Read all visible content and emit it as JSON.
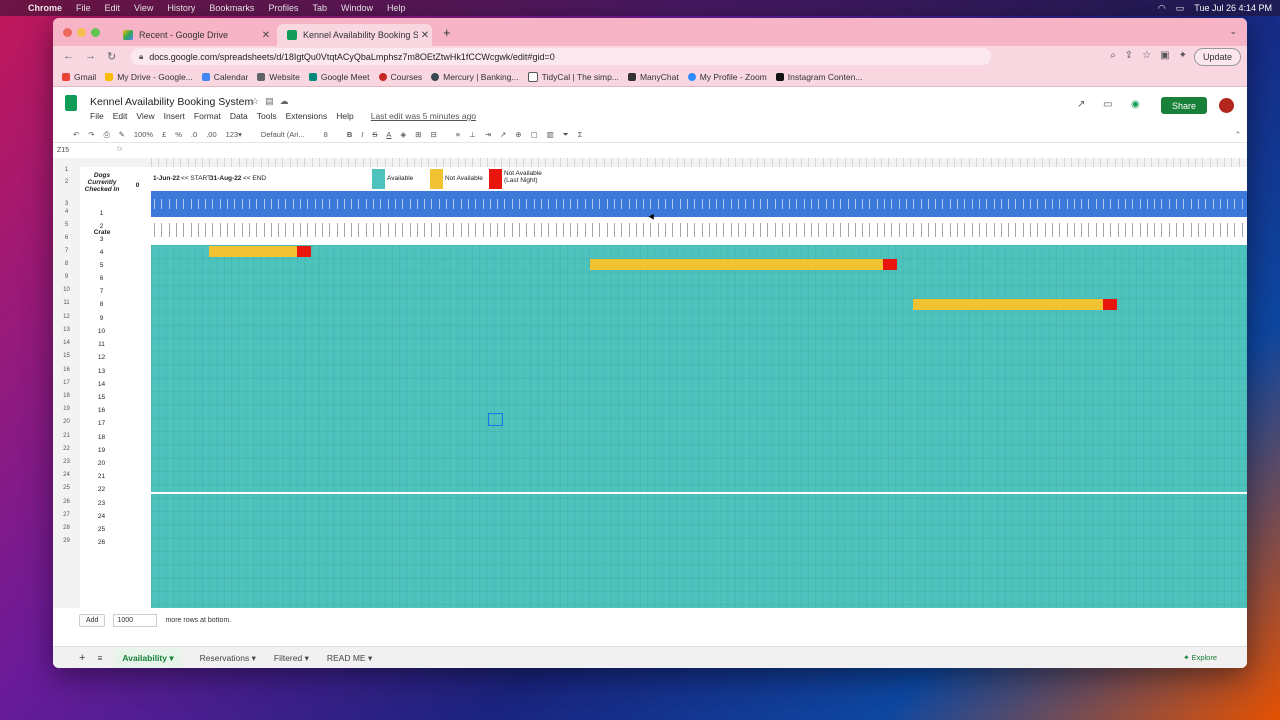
{
  "menubar": {
    "app": "Chrome",
    "items": [
      "File",
      "Edit",
      "View",
      "History",
      "Bookmarks",
      "Profiles",
      "Tab",
      "Window",
      "Help"
    ],
    "datetime": "Tue Jul 26  4:14 PM"
  },
  "tabs": [
    {
      "label": "Recent - Google Drive",
      "active": false
    },
    {
      "label": "Kennel Availability Booking Sy",
      "active": true
    }
  ],
  "omnibox": {
    "url": "docs.google.com/spreadsheets/d/18IgtQu0VtqtACyQbaLmphsz7m8OEtZtwHk1fCCWcgwk/edit#gid=0"
  },
  "update_label": "Update",
  "bookmarks": [
    "Gmail",
    "My Drive - Google...",
    "Calendar",
    "Website",
    "Google Meet",
    "Courses",
    "Mercury | Banking...",
    "TidyCal | The simp...",
    "ManyChat",
    "My Profile - Zoom",
    "Instagram Conten..."
  ],
  "sheet": {
    "title": "Kennel Availability Booking System",
    "menus": [
      "File",
      "Edit",
      "View",
      "Insert",
      "Format",
      "Data",
      "Tools",
      "Extensions",
      "Help"
    ],
    "last_edit": "Last edit was 5 minutes ago",
    "share_label": "Share",
    "zoom": "100%",
    "font": "Default (Ari...",
    "font_size": "8",
    "name_box": "Z15",
    "fx": "fx"
  },
  "grid": {
    "dogs_label": "Dogs Currently Checked In",
    "dogs_count": "0",
    "start_date": "1-Jun-22",
    "start_tag": "<< START",
    "end_date": "31-Aug-22",
    "end_tag": "<< END",
    "legend": [
      {
        "label": "Available",
        "color": "#4ec3be"
      },
      {
        "label": "Not Available",
        "color": "#f1c232"
      },
      {
        "label": "Not Available (Last Night)",
        "color": "#e8160c"
      }
    ],
    "crate_header": "Crate",
    "crates": [
      "1",
      "2",
      "3",
      "4",
      "5",
      "6",
      "7",
      "8",
      "9",
      "10",
      "11",
      "12",
      "13",
      "14",
      "15",
      "16",
      "17",
      "18",
      "19",
      "20",
      "21",
      "22",
      "23",
      "24",
      "25",
      "26"
    ],
    "row_numbers": [
      "1",
      "2",
      "3",
      "4",
      "5",
      "6",
      "7",
      "8",
      "9",
      "10",
      "11",
      "12",
      "13",
      "14",
      "15",
      "16",
      "17",
      "18",
      "19",
      "20",
      "21",
      "22",
      "23",
      "24",
      "25",
      "26",
      "27",
      "28",
      "29"
    ]
  },
  "bottom": {
    "add_label": "Add",
    "rows_value": "1000",
    "rows_suffix": "more rows at bottom."
  },
  "sheet_tabs": [
    "Availability",
    "Reservations",
    "Filtered",
    "READ ME"
  ],
  "explore_label": "Explore"
}
